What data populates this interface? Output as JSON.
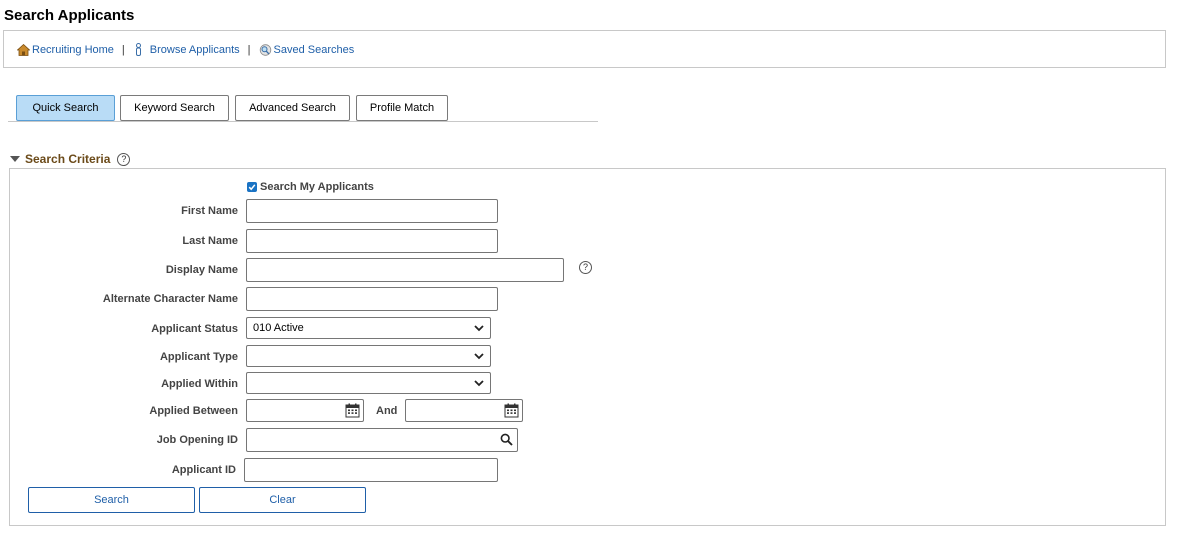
{
  "page": {
    "title": "Search Applicants"
  },
  "nav": {
    "recruiting_home": "Recruiting Home",
    "browse_applicants": "Browse Applicants",
    "saved_searches": "Saved Searches",
    "separator": "|"
  },
  "tabs": [
    {
      "label": "Quick Search",
      "active": true
    },
    {
      "label": "Keyword Search",
      "active": false
    },
    {
      "label": "Advanced Search",
      "active": false
    },
    {
      "label": "Profile Match",
      "active": false
    }
  ],
  "criteria": {
    "section_title": "Search Criteria",
    "help_glyph": "?",
    "search_my_applicants": {
      "label": "Search My Applicants",
      "checked": true
    },
    "first_name": {
      "label": "First Name",
      "value": ""
    },
    "last_name": {
      "label": "Last Name",
      "value": ""
    },
    "display_name": {
      "label": "Display Name",
      "value": ""
    },
    "alternate_character_name": {
      "label": "Alternate Character Name",
      "value": ""
    },
    "applicant_status": {
      "label": "Applicant Status",
      "value": "010 Active"
    },
    "applicant_type": {
      "label": "Applicant Type",
      "value": ""
    },
    "applied_within": {
      "label": "Applied Within",
      "value": ""
    },
    "applied_between": {
      "label": "Applied Between",
      "and_label": "And",
      "from": "",
      "to": ""
    },
    "job_opening_id": {
      "label": "Job Opening ID",
      "value": ""
    },
    "applicant_id": {
      "label": "Applicant ID",
      "value": ""
    }
  },
  "buttons": {
    "search": "Search",
    "clear": "Clear"
  },
  "colors": {
    "link": "#1f5fa8",
    "section_title": "#6b4a19",
    "active_tab": "#b9dcf6",
    "checkbox": "#1a73c4"
  }
}
